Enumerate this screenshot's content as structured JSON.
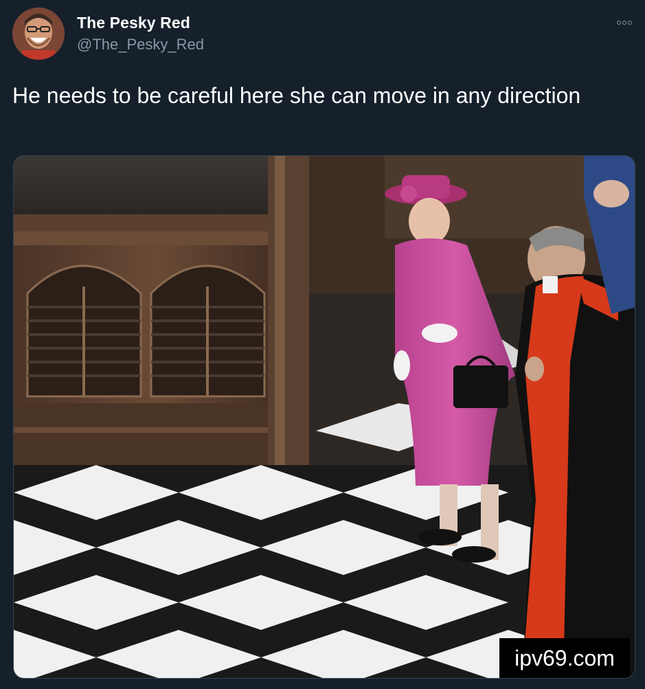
{
  "user": {
    "display_name": "The Pesky Red",
    "handle": "@The_Pesky_Red",
    "avatar_icon": "user-avatar"
  },
  "tweet": {
    "text": "He needs to be careful here she can move in any direction"
  },
  "media": {
    "watermark": "ipv69.com",
    "floor_colors": [
      "#f2f2f2",
      "#1a1a1a"
    ]
  },
  "menu": {
    "icon": "more-options-icon"
  },
  "colors": {
    "background": "#15202b",
    "secondary_text": "#8899a6",
    "border": "#38444d"
  }
}
